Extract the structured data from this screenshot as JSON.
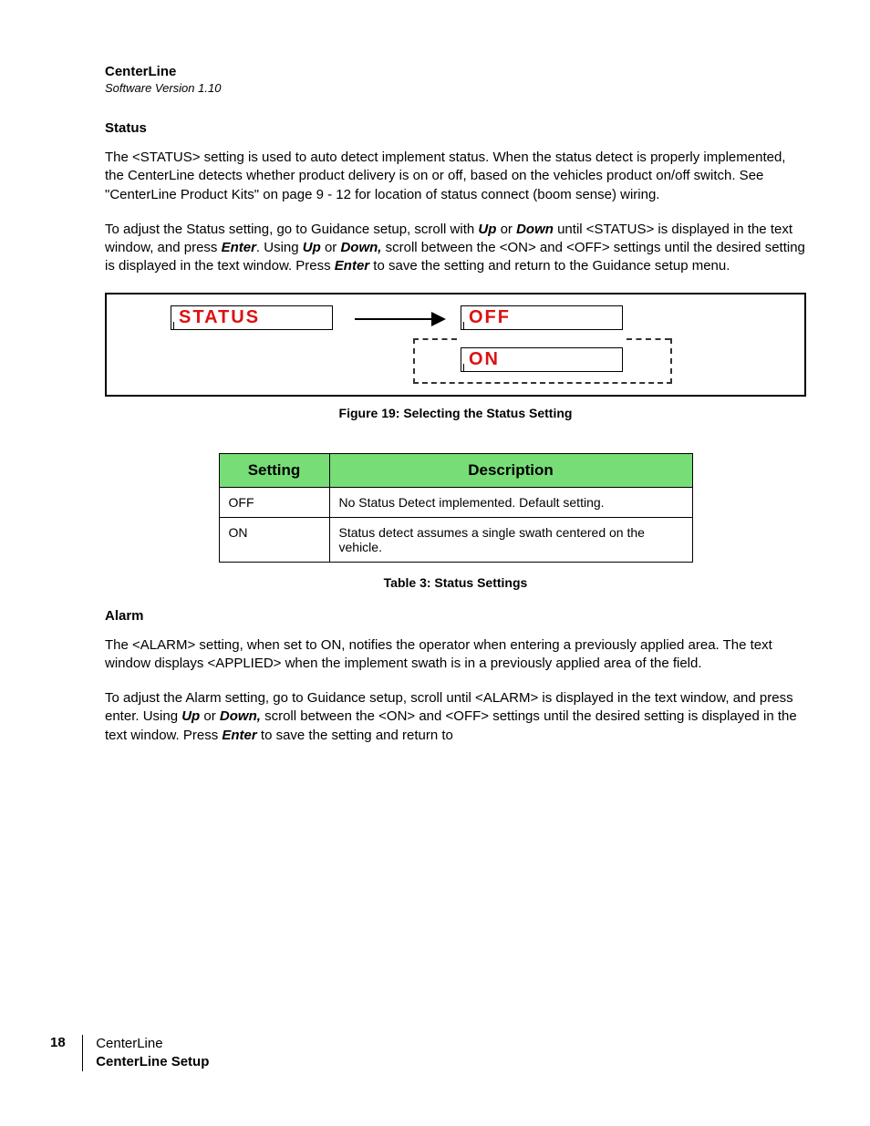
{
  "header": {
    "title": "CenterLine",
    "version": "Software Version 1.10"
  },
  "status_section": {
    "heading": "Status",
    "para1_parts": {
      "t1": "The <STATUS> setting is used to auto detect implement status. When the status detect is properly implemented, the CenterLine detects whether product delivery is on or off, based on the vehicles product on/off switch. See \"CenterLine Product Kits\" on page 9 - 12 for location of status connect (boom sense) wiring."
    },
    "para2_parts": {
      "t1": "To adjust the Status setting, go to Guidance setup, scroll with ",
      "k1": "Up",
      "t2": " or ",
      "k2": "Down",
      "t3": " until <STATUS> is displayed in the text window, and press ",
      "k3": "Enter",
      "t4": ". Using ",
      "k4": "Up",
      "t5": " or ",
      "k5": "Down,",
      "t6": " scroll between the <ON> and <OFF> settings until the desired setting is displayed in the text window. Press ",
      "k6": "Enter",
      "t7": " to save the setting and return to the Guidance setup menu."
    }
  },
  "figure": {
    "lcd_status": "STATUS",
    "lcd_off": "OFF",
    "lcd_on": "ON",
    "caption": "Figure 19: Selecting the Status Setting"
  },
  "table": {
    "headers": {
      "c1": "Setting",
      "c2": "Description"
    },
    "rows": [
      {
        "c1": "OFF",
        "c2": "No Status Detect implemented. Default setting."
      },
      {
        "c1": "ON",
        "c2": "Status detect assumes a single swath centered on the vehicle."
      }
    ],
    "caption": "Table 3: Status Settings"
  },
  "alarm_section": {
    "heading": "Alarm",
    "para1": "The <ALARM> setting, when set to ON, notifies the operator when entering a previously applied area. The text window displays <APPLIED> when the implement swath is in a previously applied area of the field.",
    "para2_parts": {
      "t1": "To adjust the Alarm setting, go to Guidance setup, scroll until <ALARM> is displayed in the text window, and press enter. Using ",
      "k1": "Up",
      "t2": " or ",
      "k2": "Down,",
      "t3": " scroll between the <ON> and <OFF> settings until the desired setting is displayed in the text window. Press ",
      "k3": "Enter",
      "t4": " to save the setting and return to"
    }
  },
  "footer": {
    "page": "18",
    "line1": "CenterLine",
    "line2": "CenterLine Setup"
  }
}
